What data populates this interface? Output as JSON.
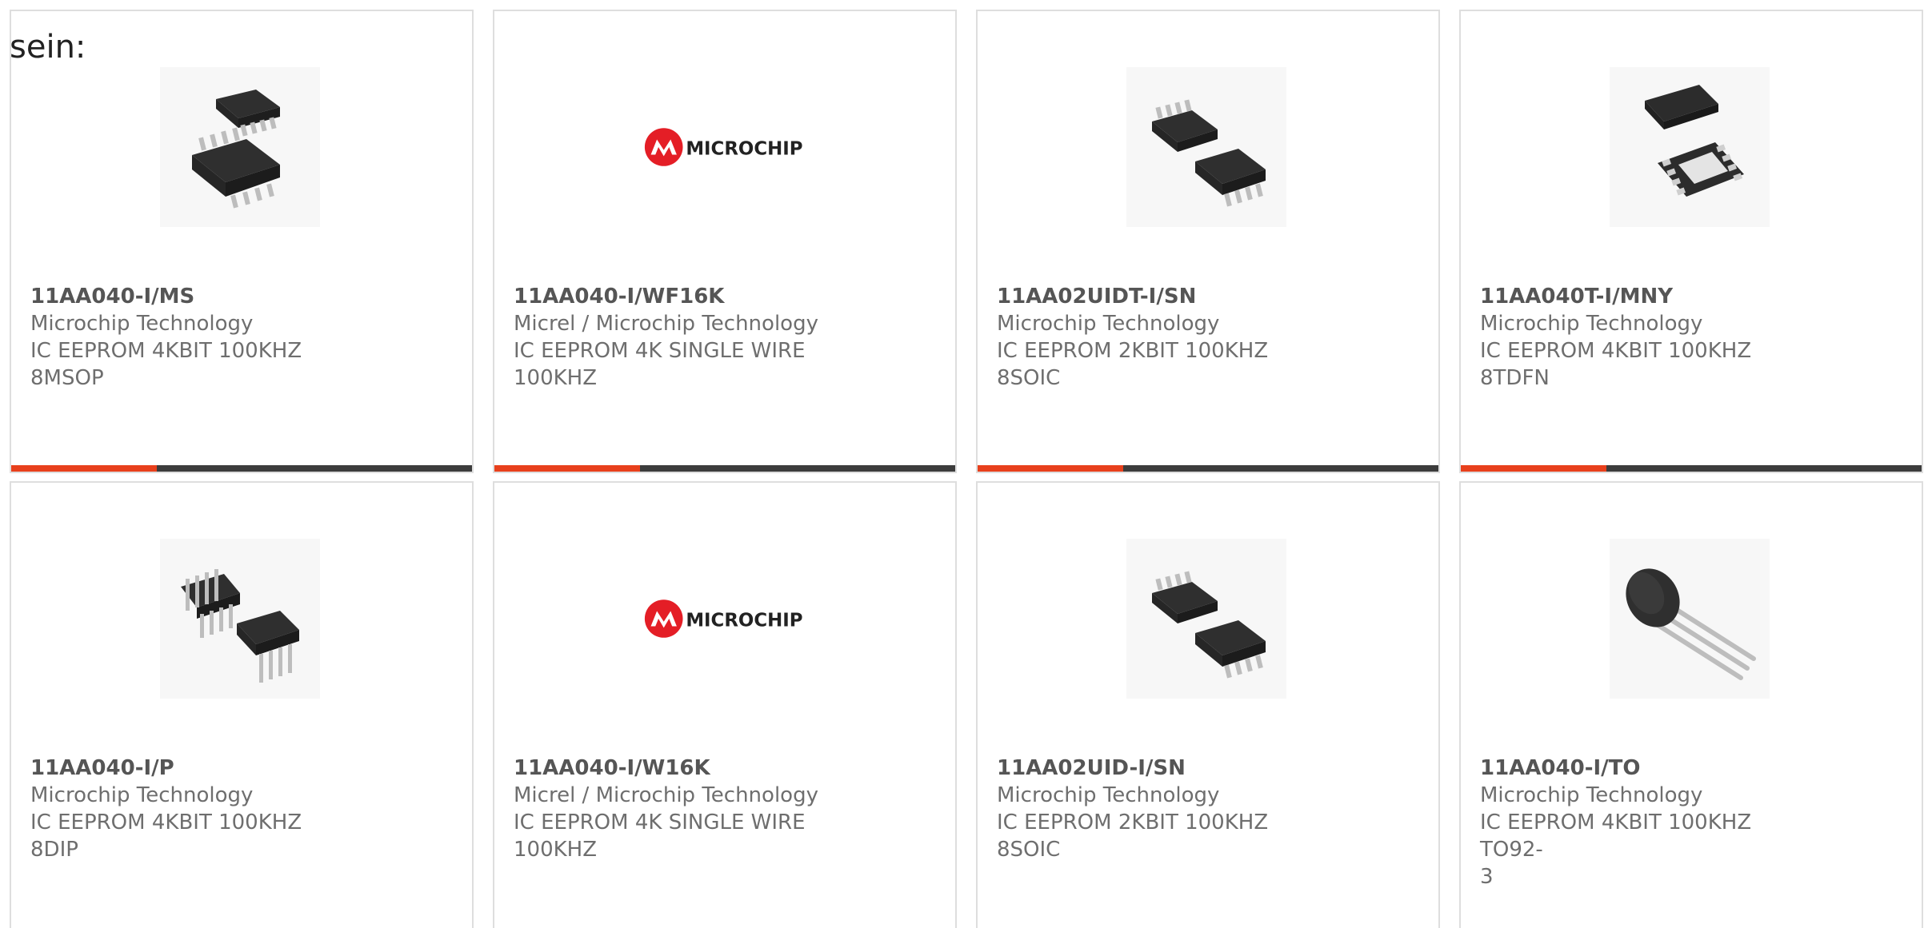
{
  "intro_text": "sein:",
  "colors": {
    "accent": "#e8401c",
    "bar": "#3c3c3c",
    "microchip_red": "#e41e26"
  },
  "products": [
    {
      "part": "11AA040-I/MS",
      "manufacturer": "Microchip Technology",
      "desc1": "IC EEPROM 4KBIT 100KHZ",
      "desc2": "8MSOP",
      "image": "msop-chip-icon"
    },
    {
      "part": "11AA040-I/WF16K",
      "manufacturer": "Micrel / Microchip Technology",
      "desc1": "IC EEPROM 4K SINGLE WIRE",
      "desc2": "100KHZ",
      "image": "microchip-logo",
      "logo_text": "MICROCHIP"
    },
    {
      "part": "11AA02UIDT-I/SN",
      "manufacturer": "Microchip Technology",
      "desc1": "IC EEPROM 2KBIT 100KHZ 8SOIC",
      "desc2": "",
      "image": "soic-chip-icon"
    },
    {
      "part": "11AA040T-I/MNY",
      "manufacturer": "Microchip Technology",
      "desc1": "IC EEPROM 4KBIT 100KHZ",
      "desc2": "8TDFN",
      "image": "tdfn-chip-icon"
    },
    {
      "part": "11AA040-I/P",
      "manufacturer": "Microchip Technology",
      "desc1": "IC EEPROM 4KBIT 100KHZ 8DIP",
      "desc2": "",
      "image": "dip-chip-icon"
    },
    {
      "part": "11AA040-I/W16K",
      "manufacturer": "Micrel / Microchip Technology",
      "desc1": "IC EEPROM 4K SINGLE WIRE",
      "desc2": "100KHZ",
      "image": "microchip-logo",
      "logo_text": "MICROCHIP"
    },
    {
      "part": "11AA02UID-I/SN",
      "manufacturer": "Microchip Technology",
      "desc1": "IC EEPROM 2KBIT 100KHZ 8SOIC",
      "desc2": "",
      "image": "soic-chip-icon"
    },
    {
      "part": "11AA040-I/TO",
      "manufacturer": "Microchip Technology",
      "desc1": "IC EEPROM 4KBIT 100KHZ TO92-",
      "desc2": "3",
      "image": "to92-chip-icon"
    }
  ]
}
